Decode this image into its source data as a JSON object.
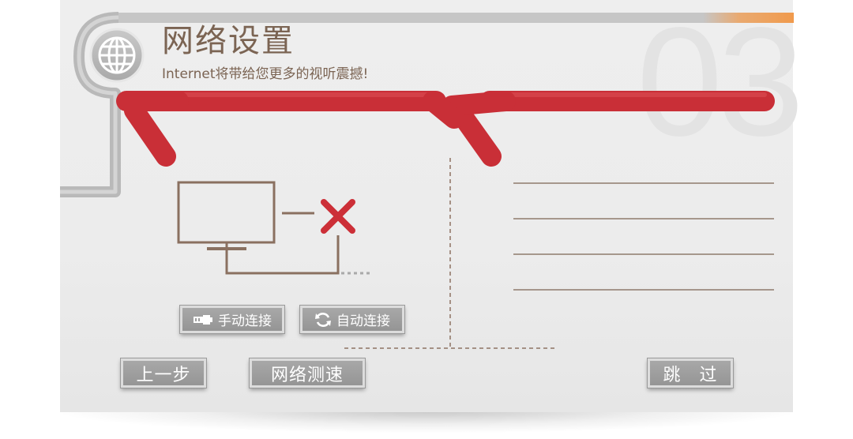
{
  "header": {
    "title": "网络设置",
    "subtitle": "Internet将带给您更多的视听震撼!",
    "step_number": "03"
  },
  "buttons": {
    "manual_connect": "手动连接",
    "auto_connect": "自动连接",
    "previous": "上一步",
    "speed_test": "网络测速",
    "skip": "跳　过"
  },
  "network_status": {
    "connected": false
  },
  "info_lines": [
    "",
    "",
    "",
    ""
  ],
  "colors": {
    "accent_red": "#cc2f37",
    "text_brown": "#7b6453",
    "button_gray": "#9e9e9e",
    "orange_accent": "#f2a25a"
  },
  "icons": {
    "header": "globe-icon",
    "manual": "ethernet-plug-icon",
    "auto": "refresh-icon",
    "device": "tv-monitor-icon",
    "status": "disconnected-x-icon"
  }
}
